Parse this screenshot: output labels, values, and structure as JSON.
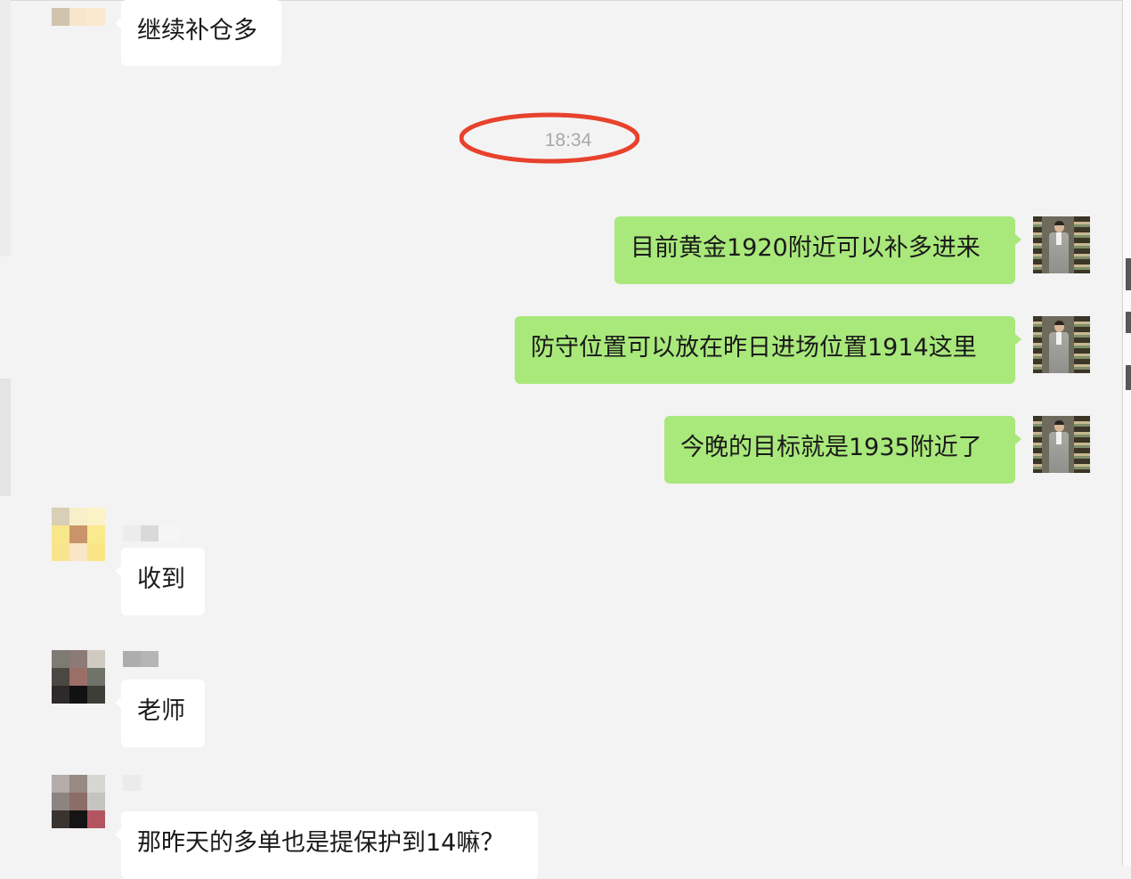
{
  "chat": {
    "timestamp": "18:34",
    "messages": [
      {
        "side": "left",
        "text": "继续补仓多"
      },
      {
        "side": "right",
        "text": "目前黄金1920附近可以补多进来"
      },
      {
        "side": "right",
        "text": "防守位置可以放在昨日进场位置1914这里"
      },
      {
        "side": "right",
        "text": "今晚的目标就是1935附近了"
      },
      {
        "side": "left",
        "text": "收到"
      },
      {
        "side": "left",
        "text": "老师"
      },
      {
        "side": "left",
        "text": "那昨天的多单也是提保护到14嘛？"
      }
    ]
  },
  "colors": {
    "background": "#f3f3f3",
    "incoming_bubble": "#ffffff",
    "outgoing_bubble": "#a9e87b",
    "timestamp_text": "#a8a8a8",
    "highlight_ring": "#e8412c"
  }
}
